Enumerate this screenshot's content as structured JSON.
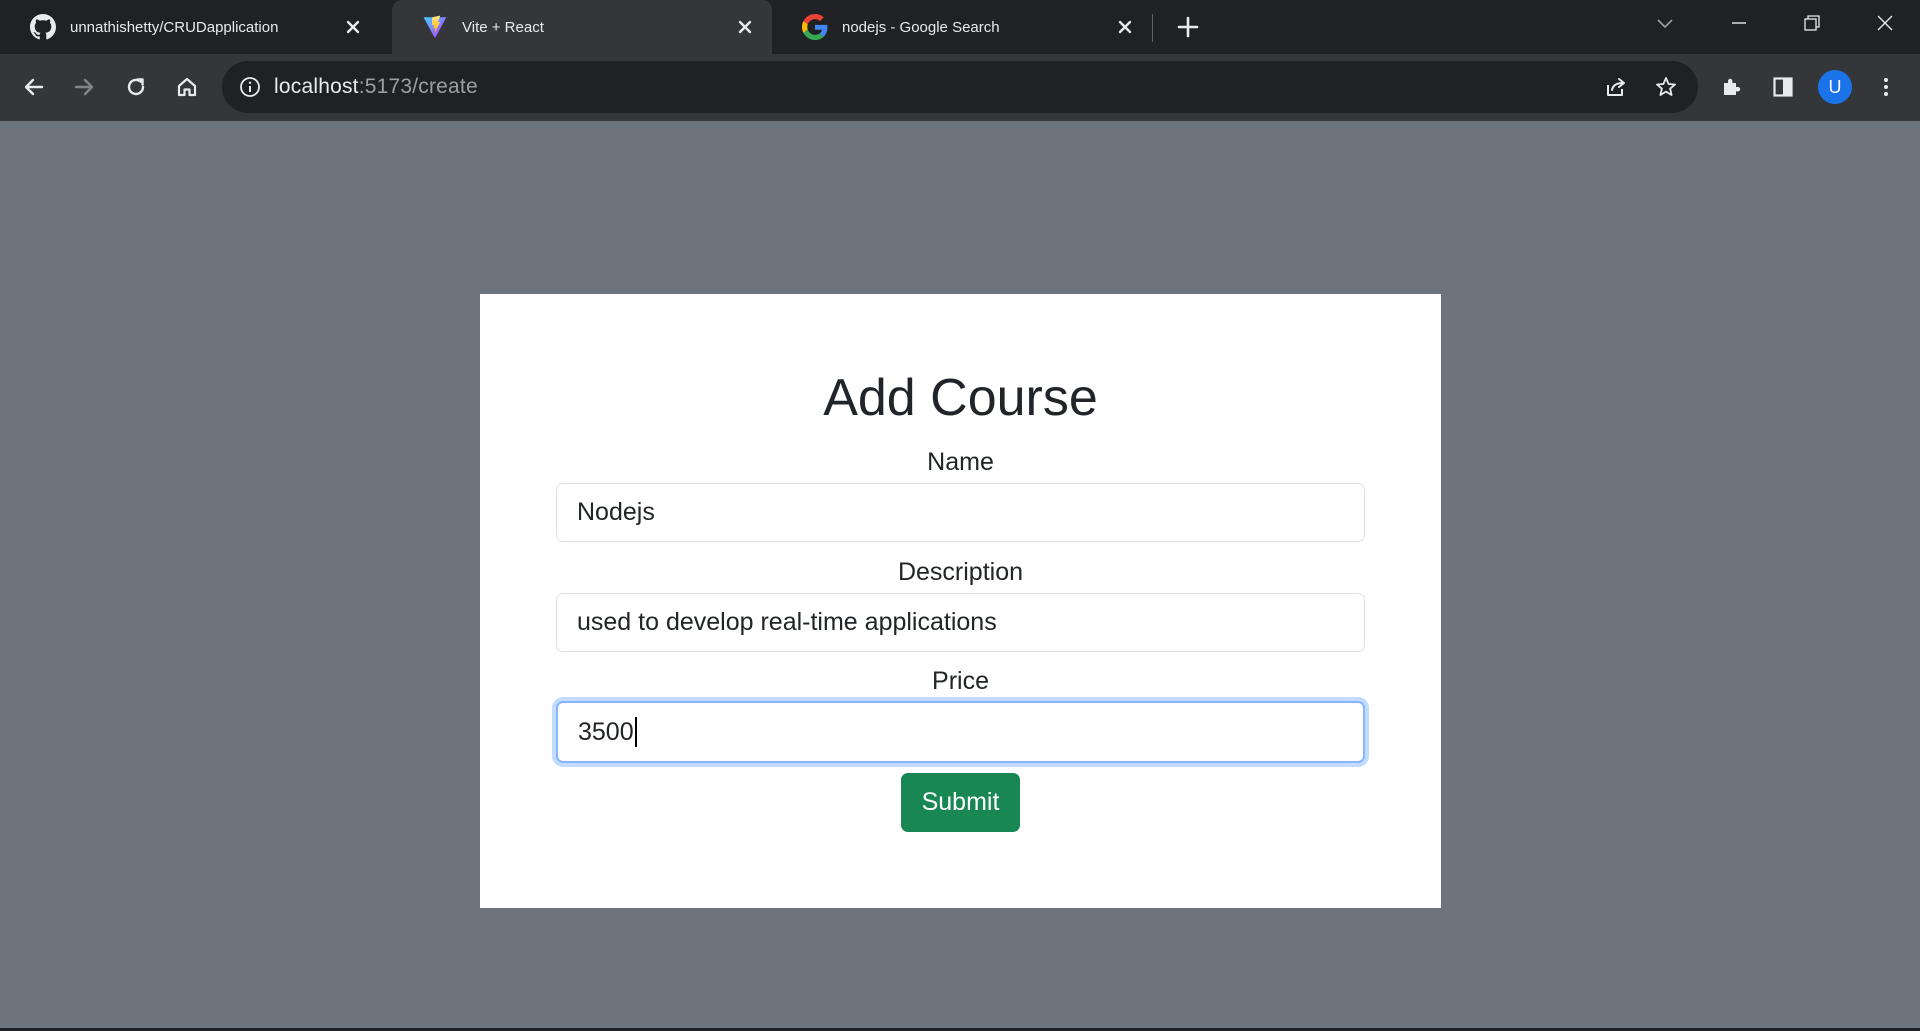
{
  "browser": {
    "tabs": [
      {
        "title": "unnathishetty/CRUDapplication",
        "favicon": "github-icon"
      },
      {
        "title": "Vite + React",
        "favicon": "vite-icon",
        "active": true
      },
      {
        "title": "nodejs - Google Search",
        "favicon": "google-icon"
      }
    ],
    "address_bar": {
      "host": "localhost",
      "rest": ":5173/create"
    },
    "profile_initial": "U"
  },
  "page": {
    "heading": "Add Course",
    "fields": [
      {
        "label": "Name",
        "value": "Nodejs"
      },
      {
        "label": "Description",
        "value": "used to develop real-time applications"
      },
      {
        "label": "Price",
        "value": "3500",
        "focused": true
      }
    ],
    "submit_label": "Submit"
  },
  "colors": {
    "page_background": "#6c757d",
    "submit_button": "#198754",
    "focus_ring": "#86b7fe",
    "profile_avatar": "#1a73e8"
  }
}
